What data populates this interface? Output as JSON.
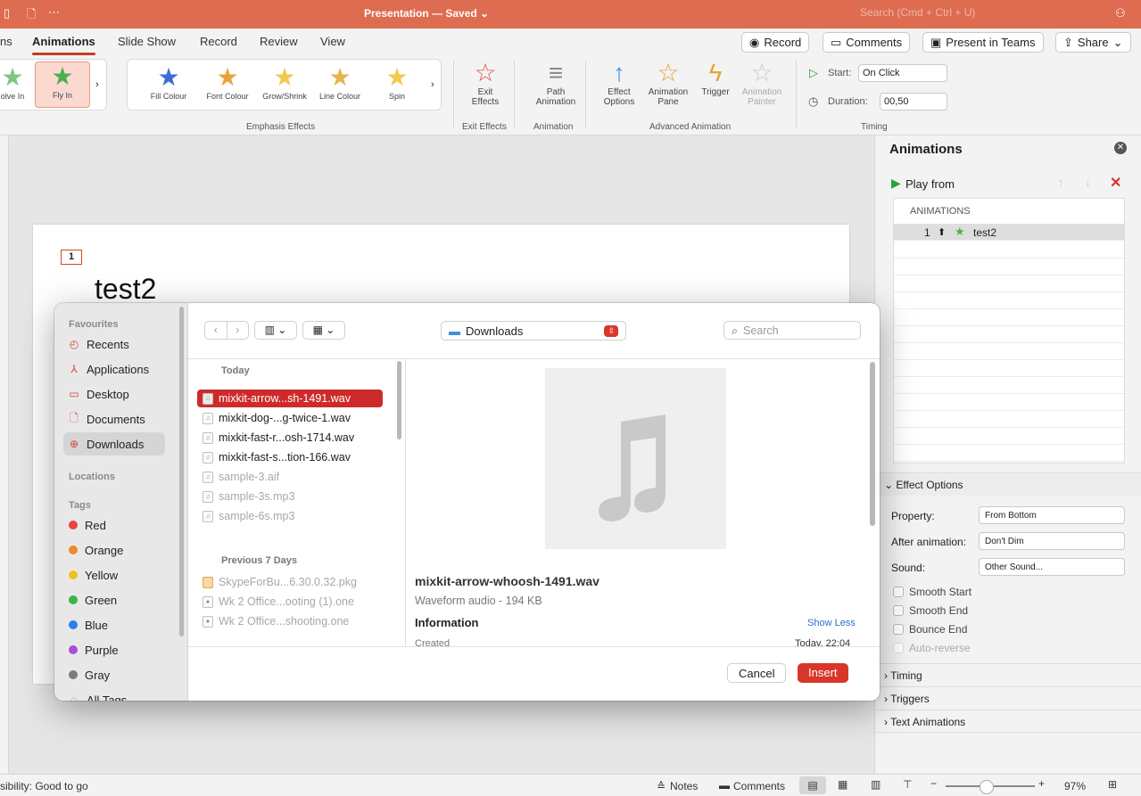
{
  "titlebar": {
    "title": "Presentation — Saved ⌄",
    "search_placeholder": "Search (Cmd + Ctrl + U)"
  },
  "tabs": {
    "partial": "ns",
    "animations": "Animations",
    "slideshow": "Slide Show",
    "record": "Record",
    "review": "Review",
    "view": "View"
  },
  "top_buttons": {
    "record": "Record",
    "comments": "Comments",
    "present": "Present in Teams",
    "share": "Share"
  },
  "ribbon": {
    "entrance": [
      {
        "label": "olve In"
      },
      {
        "label": "Fly In"
      }
    ],
    "emphasis": [
      {
        "label": "Fill Colour"
      },
      {
        "label": "Font Colour"
      },
      {
        "label": "Grow/Shrink"
      },
      {
        "label": "Line Colour"
      },
      {
        "label": "Spin"
      }
    ],
    "group_emphasis": "Emphasis Effects",
    "exit": "Exit\nEffects",
    "group_exit": "Exit Effects",
    "path": "Path\nAnimation",
    "group_animation": "Animation",
    "effect_options": "Effect\nOptions",
    "animation_pane": "Animation\nPane",
    "trigger": "Trigger",
    "animation_painter": "Animation\nPainter",
    "group_advanced": "Advanced Animation",
    "start_label": "Start:",
    "start_value": "On Click",
    "duration_label": "Duration:",
    "duration_value": "00,50",
    "group_timing": "Timing"
  },
  "slide": {
    "number": "1",
    "title": "test2"
  },
  "pane": {
    "title": "Animations",
    "play_from": "Play from",
    "list_header": "ANIMATIONS",
    "items": [
      {
        "index": "1",
        "name": "test2"
      }
    ],
    "effect_options": "Effect Options",
    "property_label": "Property:",
    "property_value": "From Bottom",
    "after_label": "After animation:",
    "after_value": "Don't Dim",
    "sound_label": "Sound:",
    "sound_value": "Other Sound...",
    "checks": [
      "Smooth Start",
      "Smooth End",
      "Bounce End",
      "Auto-reverse"
    ],
    "timing": "Timing",
    "triggers": "Triggers",
    "text_animations": "Text Animations"
  },
  "statusbar": {
    "accessibility": "sibility: Good to go",
    "notes": "Notes",
    "comments": "Comments",
    "zoom": "97%"
  },
  "dialog": {
    "favourites": "Favourites",
    "side_items": [
      "Recents",
      "Applications",
      "Desktop",
      "Documents",
      "Downloads"
    ],
    "locations": "Locations",
    "tags_head": "Tags",
    "tags": [
      {
        "name": "Red",
        "color": "#e8453c"
      },
      {
        "name": "Orange",
        "color": "#f0892a"
      },
      {
        "name": "Yellow",
        "color": "#f2c21b"
      },
      {
        "name": "Green",
        "color": "#3bb54a"
      },
      {
        "name": "Blue",
        "color": "#2c7df0"
      },
      {
        "name": "Purple",
        "color": "#a450d6"
      },
      {
        "name": "Gray",
        "color": "#7b7b7b"
      }
    ],
    "all_tags": "All Tags...",
    "location": "Downloads",
    "search_placeholder": "Search",
    "today": "Today",
    "files_today": [
      {
        "name": "mixkit-arrow...sh-1491.wav"
      },
      {
        "name": "mixkit-dog-...g-twice-1.wav"
      },
      {
        "name": "mixkit-fast-r...osh-1714.wav"
      },
      {
        "name": "mixkit-fast-s...tion-166.wav"
      },
      {
        "name": "sample-3.aif"
      },
      {
        "name": "sample-3s.mp3"
      },
      {
        "name": "sample-6s.mp3"
      }
    ],
    "prev7": "Previous 7 Days",
    "files_prev": [
      {
        "name": "SkypeForBu...6.30.0.32.pkg"
      },
      {
        "name": "Wk 2 Office...ooting (1).one"
      },
      {
        "name": "Wk 2 Office...shooting.one"
      }
    ],
    "preview_name": "mixkit-arrow-whoosh-1491.wav",
    "preview_kind": "Waveform audio - 194 KB",
    "info": "Information",
    "show_less": "Show Less",
    "created_label": "Created",
    "created_value": "Today, 22:04",
    "cancel": "Cancel",
    "insert": "Insert"
  }
}
